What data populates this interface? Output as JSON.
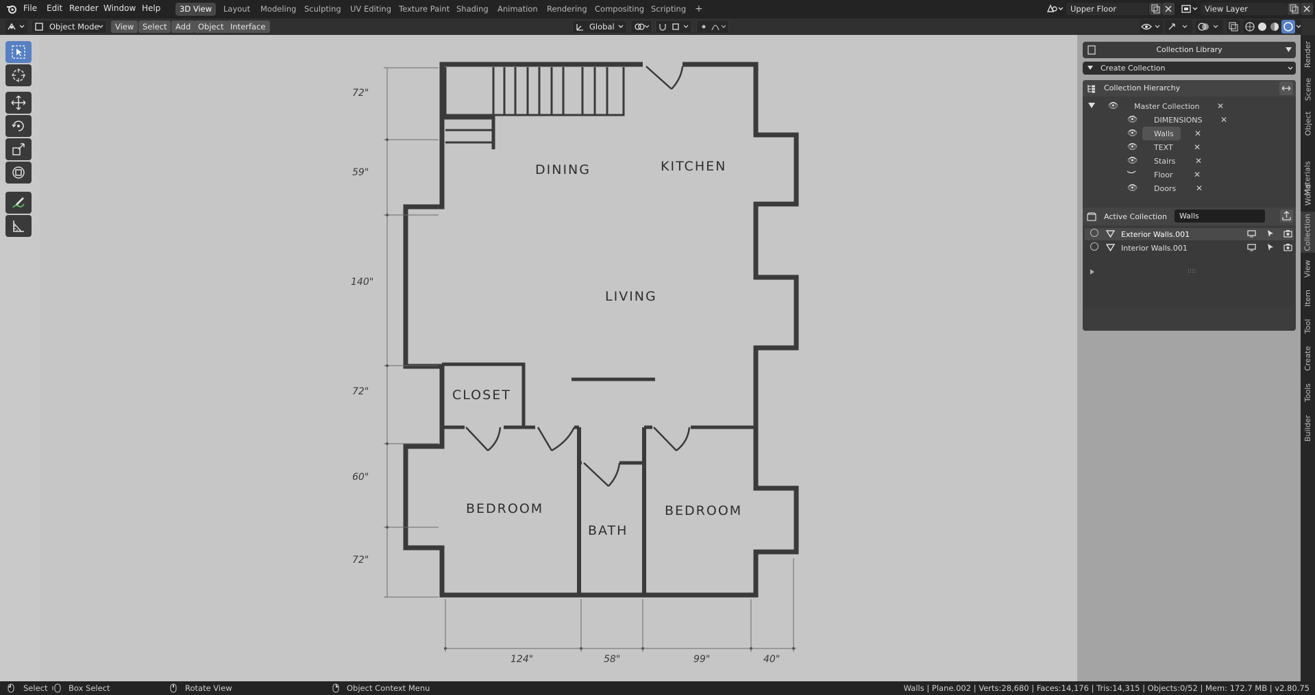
{
  "topbar": {
    "menus": [
      "File",
      "Edit",
      "Render",
      "Window",
      "Help"
    ],
    "workspaces": [
      "3D View",
      "Layout",
      "Modeling",
      "Sculpting",
      "UV Editing",
      "Texture Paint",
      "Shading",
      "Animation",
      "Rendering",
      "Compositing",
      "Scripting"
    ],
    "active_workspace": "3D View",
    "add_workspace": "+",
    "scene_name": "Upper Floor",
    "view_layer": "View Layer"
  },
  "header": {
    "mode": "Object Mode",
    "menus": [
      "View",
      "Select",
      "Add",
      "Object",
      "Interface"
    ],
    "orientation": "Global"
  },
  "toolbar": {
    "tools": [
      "select-box-icon",
      "cursor-icon",
      "move-icon",
      "rotate-icon",
      "scale-icon",
      "transform-icon",
      "annotate-icon",
      "measure-icon"
    ],
    "active_tool": "select-box-icon"
  },
  "floorplan": {
    "rooms": [
      "DINING",
      "KITCHEN",
      "LIVING",
      "CLOSET",
      "BEDROOM",
      "BATH",
      "BEDROOM"
    ],
    "vertical_dims": [
      "72\"",
      "59\"",
      "140\"",
      "72\"",
      "60\"",
      "72\""
    ],
    "horizontal_dims": [
      "124\"",
      "58\"",
      "99\"",
      "40\""
    ]
  },
  "npanel": {
    "collection_library": "Collection Library",
    "create_collection": "Create Collection",
    "hierarchy_title": "Collection Hierarchy",
    "master": "Master Collection",
    "children": [
      {
        "name": "DIMENSIONS",
        "visible": true
      },
      {
        "name": "Walls",
        "visible": true,
        "selected": true
      },
      {
        "name": "TEXT",
        "visible": true
      },
      {
        "name": "Stairs",
        "visible": true
      },
      {
        "name": "Floor",
        "visible": false
      },
      {
        "name": "Doors",
        "visible": true
      }
    ],
    "active_collection_label": "Active Collection",
    "active_collection_value": "Walls",
    "objects": [
      {
        "name": "Exterior Walls.001",
        "selected": true
      },
      {
        "name": "Interior Walls.001",
        "selected": false
      }
    ]
  },
  "vtabs": [
    "Render",
    "Scene",
    "Object",
    "Materials",
    "World",
    "Collection",
    "View",
    "Item",
    "Tool",
    "Create",
    "Tools",
    "Builder"
  ],
  "active_vtab": "Collection",
  "status": {
    "select": "Select",
    "box_select": "Box Select",
    "rotate_view": "Rotate View",
    "context_menu": "Object Context Menu",
    "stats": "Walls | Plane.002 | Verts:28,680 | Faces:14,176 | Tris:14,315 | Objects:0/52 | Mem: 172.7 MB | v2.80.75"
  },
  "colors": {
    "accent": "#5680c2",
    "viewport_bg": "#c6c6c6",
    "wall": "#3a3a3a"
  }
}
